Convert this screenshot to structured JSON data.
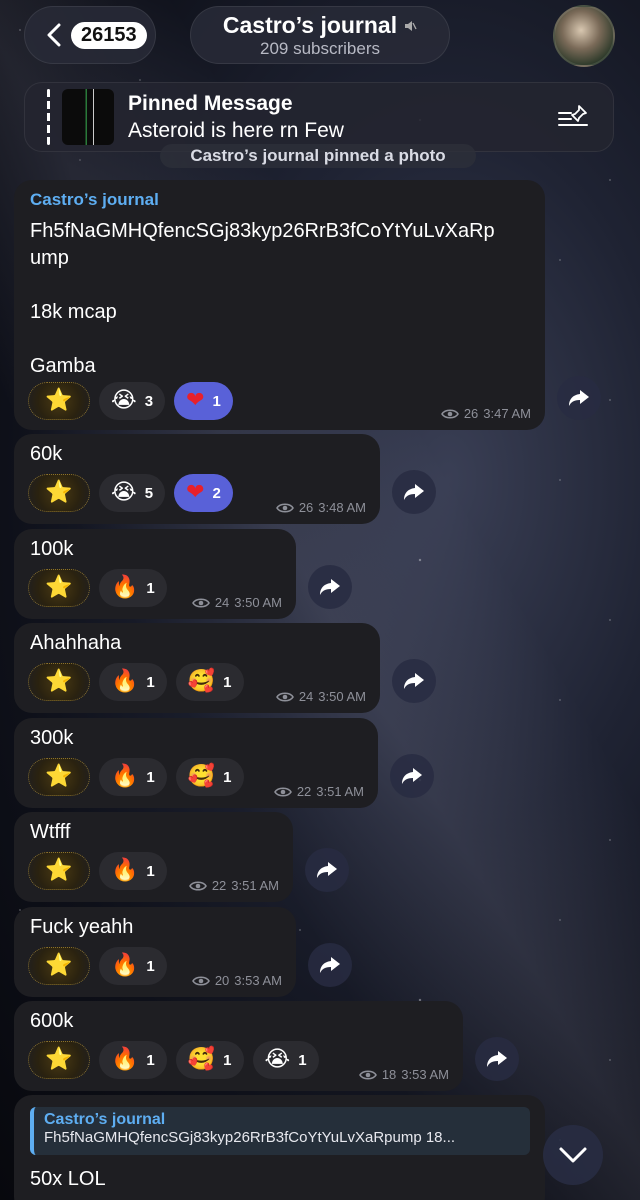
{
  "header": {
    "back_count": "26153",
    "title": "Castro’s journal",
    "subtitle": "209 subscribers"
  },
  "pinned": {
    "title": "Pinned Message",
    "body": "Asteroid is here rn Few"
  },
  "service_text": "Castro’s journal pinned a photo",
  "messages": [
    {
      "author": "Castro’s journal",
      "text": "Fh5fNaGMHQfencSGj83kyp26RrB3fCoYtYuLvXaRp\nump\n\n18k mcap\n\nGamba",
      "reactions": [
        {
          "emoji": "😭",
          "count": "3"
        },
        {
          "emoji": "❤",
          "count": "1",
          "mine": true
        }
      ],
      "views": "26",
      "time": "3:47 AM"
    },
    {
      "text": "60k",
      "reactions": [
        {
          "emoji": "😭",
          "count": "5"
        },
        {
          "emoji": "❤",
          "count": "2",
          "mine": true
        }
      ],
      "views": "26",
      "time": "3:48 AM"
    },
    {
      "text": "100k",
      "reactions": [
        {
          "emoji": "🔥",
          "count": "1"
        }
      ],
      "views": "24",
      "time": "3:50 AM"
    },
    {
      "text": "Ahahhaha",
      "reactions": [
        {
          "emoji": "🔥",
          "count": "1"
        },
        {
          "emoji": "🥰",
          "count": "1"
        }
      ],
      "views": "24",
      "time": "3:50 AM"
    },
    {
      "text": "300k",
      "reactions": [
        {
          "emoji": "🔥",
          "count": "1"
        },
        {
          "emoji": "🥰",
          "count": "1"
        }
      ],
      "views": "22",
      "time": "3:51 AM"
    },
    {
      "text": "Wtfff",
      "reactions": [
        {
          "emoji": "🔥",
          "count": "1"
        }
      ],
      "views": "22",
      "time": "3:51 AM"
    },
    {
      "text": "Fuck yeahh",
      "reactions": [
        {
          "emoji": "🔥",
          "count": "1"
        }
      ],
      "views": "20",
      "time": "3:53 AM"
    },
    {
      "text": "600k",
      "reactions": [
        {
          "emoji": "🔥",
          "count": "1"
        },
        {
          "emoji": "🥰",
          "count": "1"
        },
        {
          "emoji": "😭",
          "count": "1"
        }
      ],
      "views": "18",
      "time": "3:53 AM"
    }
  ],
  "last_message": {
    "quote_author": "Castro’s journal",
    "quote_text": "Fh5fNaGMHQfencSGj83kyp26RrB3fCoYtYuLvXaRpump 18...",
    "text": "50x LOL"
  },
  "star_emoji": "⭐",
  "icons": [
    "back-chevron-icon",
    "mute-icon",
    "pinned-list-icon",
    "eye-icon",
    "share-icon",
    "chevron-down-icon"
  ]
}
